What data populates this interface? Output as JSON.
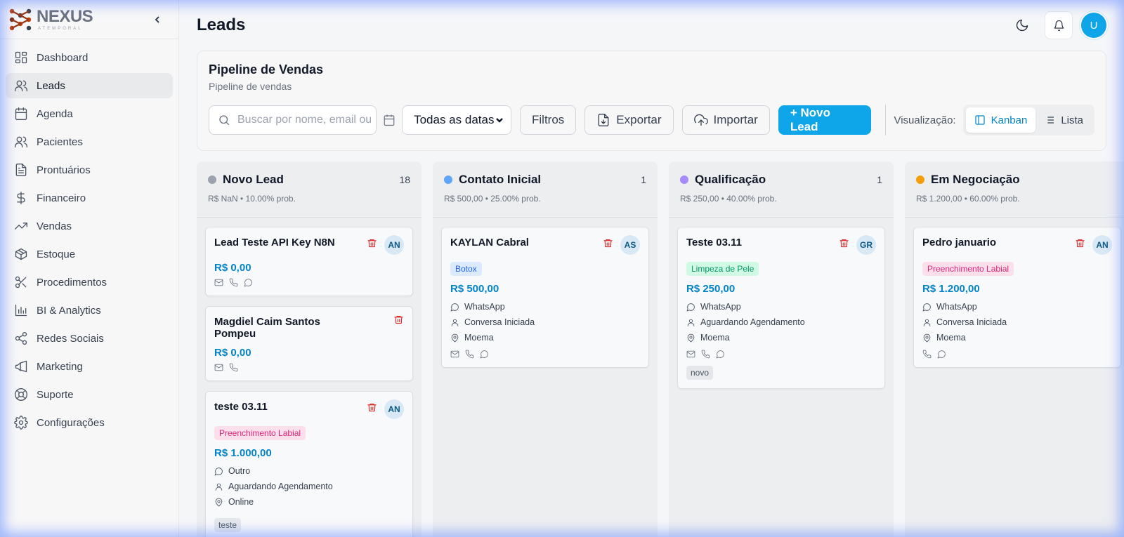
{
  "brand": {
    "name": "NEXUS",
    "subtitle": "ATEMPORAL"
  },
  "sidebar": {
    "items": [
      {
        "label": "Dashboard",
        "icon": "dashboard-icon"
      },
      {
        "label": "Leads",
        "icon": "users-icon",
        "active": true
      },
      {
        "label": "Agenda",
        "icon": "calendar-icon"
      },
      {
        "label": "Pacientes",
        "icon": "users-icon"
      },
      {
        "label": "Prontuários",
        "icon": "file-text-icon"
      },
      {
        "label": "Financeiro",
        "icon": "dollar-icon"
      },
      {
        "label": "Vendas",
        "icon": "trending-up-icon"
      },
      {
        "label": "Estoque",
        "icon": "package-icon"
      },
      {
        "label": "Procedimentos",
        "icon": "scissors-icon"
      },
      {
        "label": "BI & Analytics",
        "icon": "bar-chart-icon"
      },
      {
        "label": "Redes Sociais",
        "icon": "share-icon"
      },
      {
        "label": "Marketing",
        "icon": "megaphone-icon"
      },
      {
        "label": "Suporte",
        "icon": "life-buoy-icon"
      },
      {
        "label": "Configurações",
        "icon": "settings-icon"
      }
    ]
  },
  "header": {
    "title": "Leads",
    "avatar": "U"
  },
  "pipeline": {
    "title": "Pipeline de Vendas",
    "subtitle": "Pipeline de vendas",
    "search_placeholder": "Buscar por nome, email ou telefone",
    "date_filter": "Todas as datas",
    "filters_label": "Filtros",
    "export_label": "Exportar",
    "import_label": "Importar",
    "new_lead_label": "+ Novo Lead",
    "view_label": "Visualização:",
    "view_kanban": "Kanban",
    "view_list": "Lista"
  },
  "colors": {
    "accent": "#0ea5e9",
    "novo_lead": "#9ca3af",
    "contato_inicial": "#60a5fa",
    "qualificacao": "#a78bfa",
    "em_negociacao": "#f59e0b"
  },
  "columns": [
    {
      "title": "Novo Lead",
      "count": "18",
      "summary": "R$ NaN • 10.00% prob.",
      "cards": [
        {
          "name": "Lead Teste API Key N8N",
          "initials": "AN",
          "amount": "R$ 0,00"
        },
        {
          "name": "Magdiel Caim Santos Pompeu",
          "amount": "R$ 0,00"
        },
        {
          "name": "teste 03.11",
          "initials": "AN",
          "tag": "Preenchimento Labial",
          "amount": "R$ 1.000,00",
          "channel": "Outro",
          "status": "Aguardando Agendamento",
          "location": "Online",
          "extra_tag": "teste"
        }
      ]
    },
    {
      "title": "Contato Inicial",
      "count": "1",
      "summary": "R$ 500,00 • 25.00% prob.",
      "cards": [
        {
          "name": "KAYLAN Cabral",
          "initials": "AS",
          "tag": "Botox",
          "amount": "R$ 500,00",
          "channel": "WhatsApp",
          "status": "Conversa Iniciada",
          "location": "Moema"
        }
      ]
    },
    {
      "title": "Qualificação",
      "count": "1",
      "summary": "R$ 250,00 • 40.00% prob.",
      "cards": [
        {
          "name": "Teste 03.11",
          "initials": "GR",
          "tag": "Limpeza de Pele",
          "amount": "R$ 250,00",
          "channel": "WhatsApp",
          "status": "Aguardando Agendamento",
          "location": "Moema",
          "extra_tag": "novo"
        }
      ]
    },
    {
      "title": "Em Negociação",
      "count": "",
      "summary": "R$ 1.200,00 • 60.00% prob.",
      "cards": [
        {
          "name": "Pedro januario",
          "initials": "AN",
          "tag": "Preenchimento Labial",
          "amount": "R$ 1.200,00",
          "channel": "WhatsApp",
          "status": "Conversa Iniciada",
          "location": "Moema"
        }
      ]
    }
  ]
}
